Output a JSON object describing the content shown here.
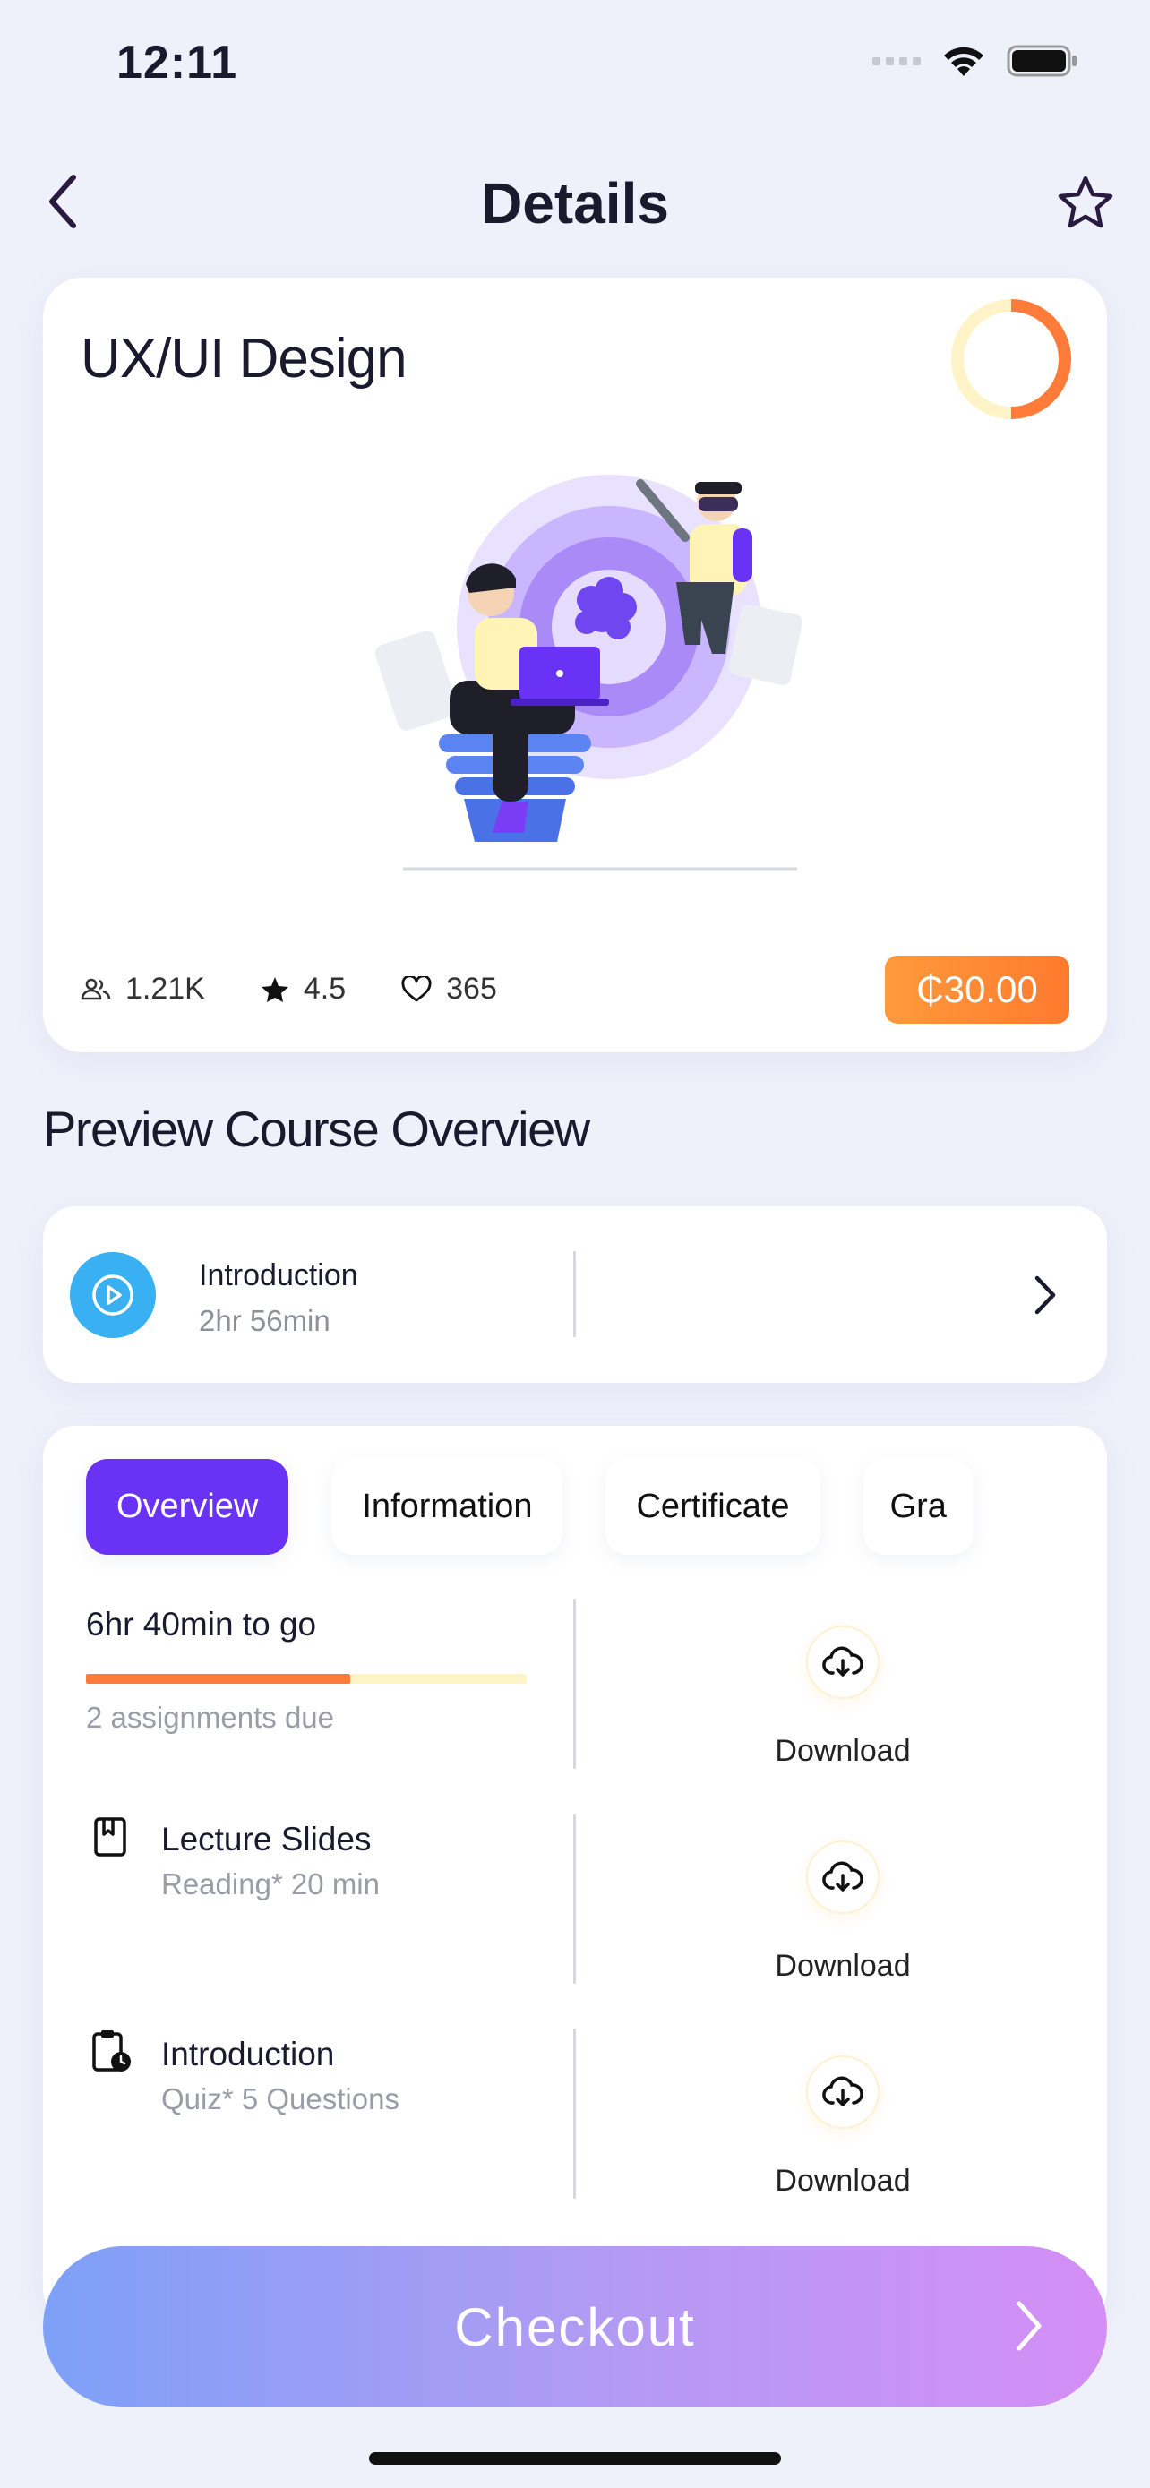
{
  "status_bar": {
    "time": "12:11"
  },
  "header": {
    "title": "Details"
  },
  "course": {
    "title": "UX/UI Design",
    "progress_ring_fraction": 0.5,
    "stats": {
      "learners": "1.21K",
      "rating": "4.5",
      "likes": "365"
    },
    "price": "₵30.00"
  },
  "preview": {
    "section_title": "Preview Course Overview",
    "intro": {
      "title": "Introduction",
      "duration": "2hr 56min"
    }
  },
  "tabs": [
    "Overview",
    "Information",
    "Certificate",
    "Gra"
  ],
  "active_tab": 0,
  "overview": {
    "time_to_go": "6hr 40min to go",
    "progress_fraction": 0.6,
    "assignments": "2 assignments due",
    "download_label": "Download",
    "items": [
      {
        "title": "Lecture Slides",
        "sub": "Reading* 20 min"
      },
      {
        "title": "Introduction",
        "sub": "Quiz* 5 Questions"
      }
    ]
  },
  "checkout": {
    "label": "Checkout"
  },
  "colors": {
    "accent": "#6a32f5",
    "price": "#ff7a2d",
    "play": "#38b0f2",
    "progress": "#ff7b3a"
  }
}
